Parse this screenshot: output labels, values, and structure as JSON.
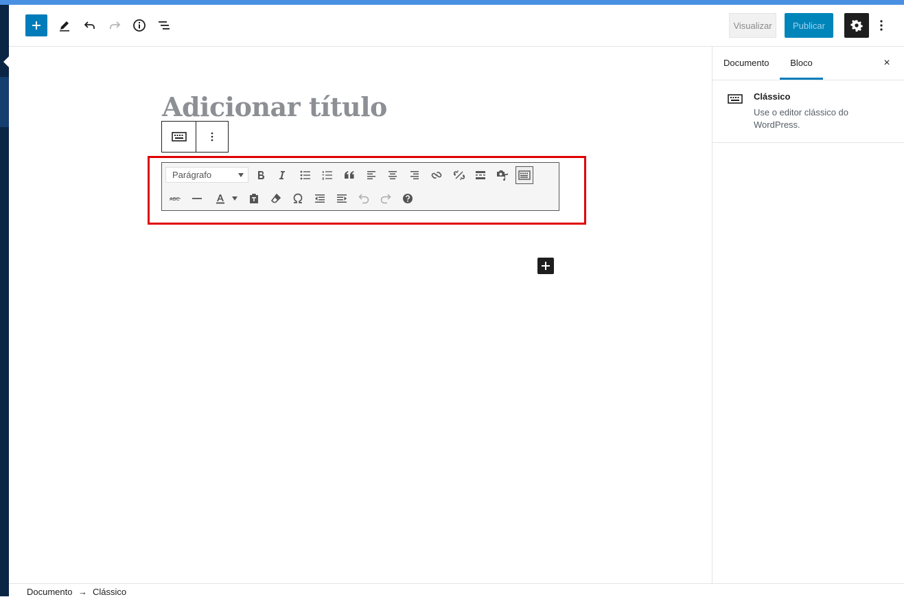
{
  "header": {
    "preview_label": "Visualizar",
    "publish_label": "Publicar"
  },
  "editor": {
    "title_placeholder": "Adicionar título",
    "format_select": "Parágrafo"
  },
  "sidebar": {
    "tabs": [
      {
        "label": "Documento"
      },
      {
        "label": "Bloco"
      }
    ],
    "close_symbol": "×",
    "block": {
      "title": "Clássico",
      "description": "Use o editor clássico do WordPress."
    }
  },
  "footer": {
    "breadcrumb": [
      "Documento",
      "→",
      "Clássico"
    ]
  },
  "colors": {
    "accent": "#007cba",
    "highlight_box": "#e00000",
    "admin_bar": "#0b2545"
  }
}
